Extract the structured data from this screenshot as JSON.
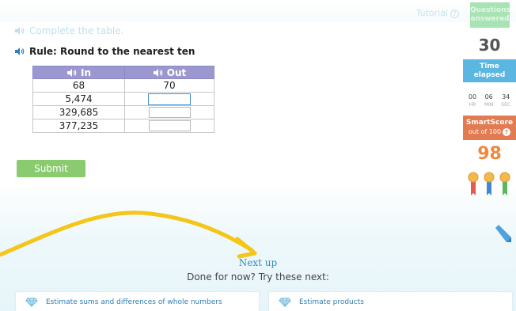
{
  "topbar": {
    "tutorial_label": "Tutorial",
    "tutorial_icon": "?"
  },
  "instruction": {
    "text": "Complete the table."
  },
  "rule": {
    "text": "Rule: Round to the nearest ten"
  },
  "table": {
    "headers": [
      "In",
      "Out"
    ],
    "rows": [
      {
        "in": "68",
        "out": "70"
      },
      {
        "in": "5,474",
        "out": ""
      },
      {
        "in": "329,685",
        "out": ""
      },
      {
        "in": "377,235",
        "out": ""
      }
    ]
  },
  "submit_label": "Submit",
  "sidebar": {
    "questions_label": "Questions answered",
    "questions_count": "30",
    "time_label": "Time elapsed",
    "timer": [
      {
        "value": "00",
        "unit": "HR"
      },
      {
        "value": "06",
        "unit": "MIN"
      },
      {
        "value": "34",
        "unit": "SEC"
      }
    ],
    "smartscore_label": "SmartScore",
    "smartscore_sub": "out of 100",
    "smartscore_help": "?",
    "smartscore_value": "98"
  },
  "next": {
    "title": "Next up",
    "subtitle": "Done for now? Try these next:",
    "items": [
      {
        "label": "Estimate sums and differences of whole numbers",
        "icon": "diamond-icon"
      },
      {
        "label": "Estimate products",
        "icon": "diamond-icon"
      }
    ]
  },
  "colors": {
    "header": "#9b98cf",
    "submit": "#8acb70",
    "time": "#5bb6e2",
    "smartscore": "#e27a52",
    "arrow": "#f5c518",
    "link": "#2d7fb3"
  }
}
